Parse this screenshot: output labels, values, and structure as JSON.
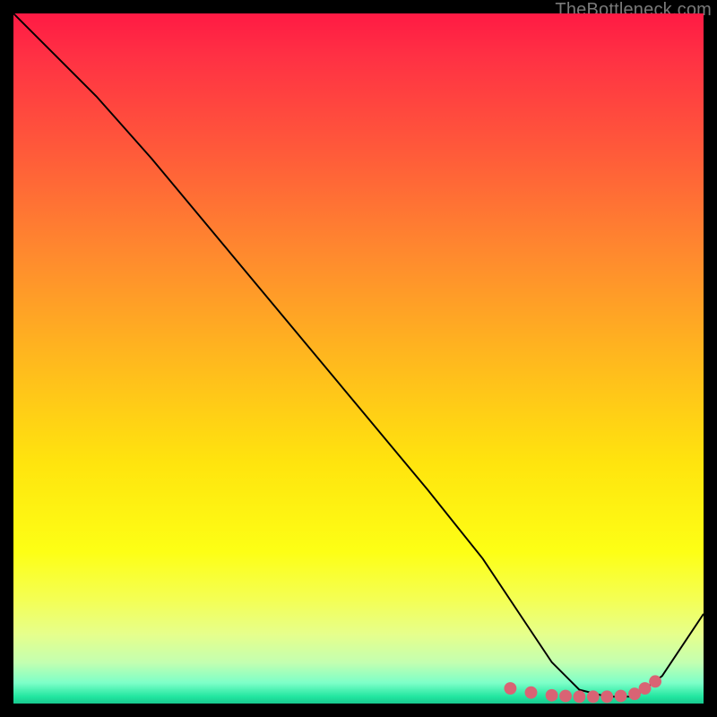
{
  "attribution": "TheBottleneck.com",
  "colors": {
    "curve": "#000000",
    "marker": "#d96374"
  },
  "chart_data": {
    "type": "line",
    "title": "",
    "xlabel": "",
    "ylabel": "",
    "xlim": [
      0,
      100
    ],
    "ylim": [
      0,
      100
    ],
    "grid": false,
    "legend": false,
    "series": [
      {
        "name": "bottleneck-curve",
        "x": [
          0,
          6,
          12,
          20,
          30,
          40,
          50,
          60,
          68,
          74,
          78,
          82,
          86,
          90,
          94,
          100
        ],
        "y": [
          100,
          94,
          88,
          79,
          67,
          55,
          43,
          31,
          21,
          12,
          6,
          2,
          1,
          1,
          4,
          13
        ]
      }
    ],
    "markers": {
      "name": "highlighted-points",
      "x": [
        72,
        75,
        78,
        80,
        82,
        84,
        86,
        88,
        90,
        91.5,
        93
      ],
      "y": [
        2.2,
        1.6,
        1.2,
        1.1,
        1.0,
        1.0,
        1.0,
        1.1,
        1.4,
        2.2,
        3.2
      ]
    }
  }
}
